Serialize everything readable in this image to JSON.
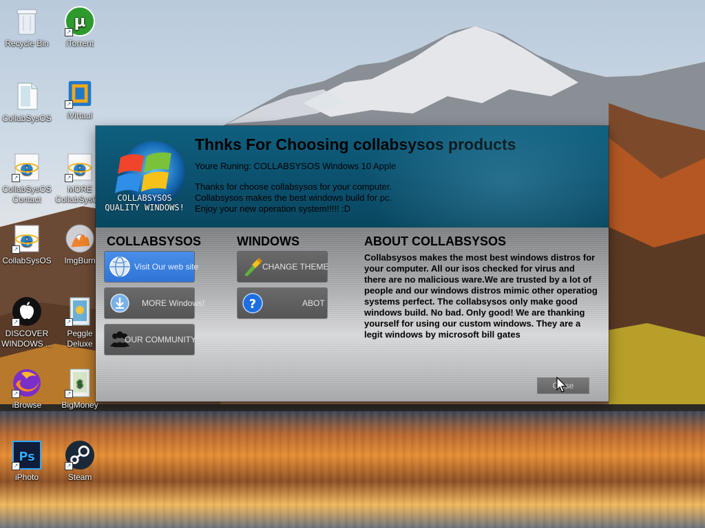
{
  "desktop": {
    "icons": [
      {
        "label": "Recycle Bin",
        "icon": "recycle-bin-icon"
      },
      {
        "label": "iTorrent",
        "icon": "utorrent-icon"
      },
      {
        "label": "CollabSysOS",
        "icon": "document-icon"
      },
      {
        "label": "iVirtaul",
        "icon": "virtual-box-icon"
      },
      {
        "label": "CollabSysOS Contact",
        "icon": "internet-explorer-icon"
      },
      {
        "label": "MORE CollabSysOS",
        "icon": "internet-explorer-icon"
      },
      {
        "label": "CollabSysOS",
        "icon": "internet-explorer-icon"
      },
      {
        "label": "ImgBurn",
        "icon": "imgburn-icon"
      },
      {
        "label": "DISCOVER WINDOWS ...",
        "icon": "apple-icon"
      },
      {
        "label": "Peggle Deluxe",
        "icon": "game-icon"
      },
      {
        "label": "iBrowse",
        "icon": "firefox-icon"
      },
      {
        "label": "BigMoney",
        "icon": "game-icon"
      },
      {
        "label": "iPhoto",
        "icon": "photoshop-icon"
      },
      {
        "label": "Steam",
        "icon": "steam-icon"
      }
    ]
  },
  "dialog": {
    "logo_line1": "COLLABSYSOS",
    "logo_line2": "QUALITY WINDOWS!",
    "title": "Thnks For Choosing collabsysos products",
    "running": "Youre Runing: COLLABSYSOS Windows 10 Apple",
    "intro": [
      "Thanks for choose collabsysos for your computer.",
      "Collabsysos makes the best windows build for pc.",
      "Enjoy your new operation system!!!!! :D"
    ],
    "columns": {
      "collabsysos": {
        "heading": "COLLABSYSOS",
        "buttons": [
          "Visit Our web site",
          "MORE Windows!",
          "OUR COMMUNITY"
        ]
      },
      "windows": {
        "heading": "WINDOWS",
        "buttons": [
          "CHANGE THEME",
          "ABOT"
        ]
      },
      "about": {
        "heading": "ABOUT COLLABSYSOS",
        "text": "Collabsysos makes the most best windows distros for your computer. All our isos checked for virus and there are no malicious ware.We are trusted by a lot of people and our windows distros mimic other operatiog systems perfect. The collabsysos only make good windows build. No bad. Only good! We are thanking yourself for using our custom windows. They are a legit windows by microsoft bill gates"
      }
    },
    "close_label": "Close"
  },
  "colors": {
    "header": "#0b4f6c",
    "tile": "#5e5e5e",
    "tile_active": "#3a82e0"
  }
}
